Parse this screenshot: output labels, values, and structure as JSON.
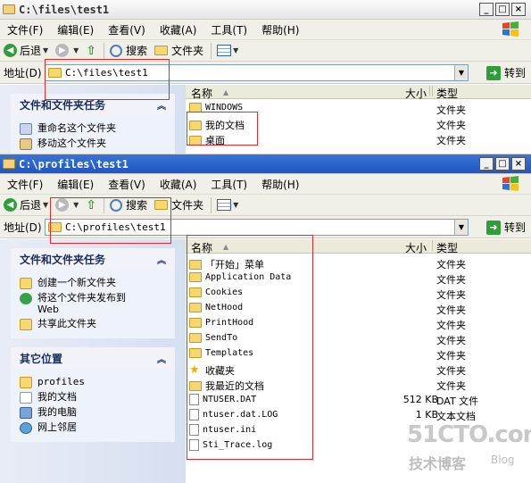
{
  "window1": {
    "title": "C:\\files\\test1",
    "address_value": "C:\\files\\test1",
    "panel_title": "文件和文件夹任务",
    "tasks": [
      {
        "label": "重命名这个文件夹",
        "icon": "rename-icon"
      },
      {
        "label": "移动这个文件夹",
        "icon": "move-icon"
      }
    ],
    "rows": [
      {
        "name": "WINDOWS",
        "type": "文件夹",
        "icon": "folder-icon"
      },
      {
        "name": "我的文档",
        "type": "文件夹",
        "icon": "folder-icon"
      },
      {
        "name": "桌面",
        "type": "文件夹",
        "icon": "folder-icon"
      }
    ]
  },
  "window2": {
    "title": "C:\\profiles\\test1",
    "address_value": "C:\\profiles\\test1",
    "panels": [
      {
        "title": "文件和文件夹任务",
        "tasks": [
          {
            "label": "创建一个新文件夹",
            "icon": "folder-icon"
          },
          {
            "label": "将这个文件夹发布到 Web",
            "icon": "globe-icon"
          },
          {
            "label": "共享此文件夹",
            "icon": "share-folder-icon"
          }
        ]
      },
      {
        "title": "其它位置",
        "tasks": [
          {
            "label": "profiles",
            "icon": "folder-icon"
          },
          {
            "label": "我的文档",
            "icon": "documents-icon"
          },
          {
            "label": "我的电脑",
            "icon": "computer-icon"
          },
          {
            "label": "网上邻居",
            "icon": "network-icon"
          }
        ]
      }
    ],
    "rows": [
      {
        "name": "「开始」菜单",
        "size": "",
        "type": "文件夹",
        "icon": "folder-icon"
      },
      {
        "name": "Application Data",
        "size": "",
        "type": "文件夹",
        "icon": "folder-icon"
      },
      {
        "name": "Cookies",
        "size": "",
        "type": "文件夹",
        "icon": "folder-icon"
      },
      {
        "name": "NetHood",
        "size": "",
        "type": "文件夹",
        "icon": "folder-icon"
      },
      {
        "name": "PrintHood",
        "size": "",
        "type": "文件夹",
        "icon": "folder-icon"
      },
      {
        "name": "SendTo",
        "size": "",
        "type": "文件夹",
        "icon": "folder-icon"
      },
      {
        "name": "Templates",
        "size": "",
        "type": "文件夹",
        "icon": "folder-icon"
      },
      {
        "name": "收藏夹",
        "size": "",
        "type": "文件夹",
        "icon": "favorites-star-icon"
      },
      {
        "name": "我最近的文档",
        "size": "",
        "type": "文件夹",
        "icon": "folder-icon"
      },
      {
        "name": "NTUSER.DAT",
        "size": "512 KB",
        "type": "DAT 文件",
        "icon": "file-icon"
      },
      {
        "name": "ntuser.dat.LOG",
        "size": "1 KB",
        "type": "文本文档",
        "icon": "file-icon"
      },
      {
        "name": "ntuser.ini",
        "size": "",
        "type": "",
        "icon": "file-icon"
      },
      {
        "name": "Sti_Trace.log",
        "size": "",
        "type": "",
        "icon": "file-icon"
      }
    ]
  },
  "menu": [
    "文件(F)",
    "编辑(E)",
    "查看(V)",
    "收藏(A)",
    "工具(T)",
    "帮助(H)"
  ],
  "toolbar": {
    "back": "后退",
    "search": "搜索",
    "folders": "文件夹"
  },
  "address_label": "地址(D)",
  "goto_label": "转到",
  "columns": {
    "name": "名称",
    "size": "大小",
    "type": "类型"
  },
  "watermark": {
    "line1": "51CTO.com",
    "line2": "技术博客",
    "line3": "Blog"
  },
  "colors": {
    "highlight": "#e02b2b",
    "active_title": "#1f56c4",
    "taskpane": "#d6dff0"
  }
}
